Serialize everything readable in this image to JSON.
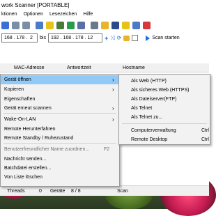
{
  "window": {
    "title": "work Scanner [PORTABLE]"
  },
  "menu": [
    "ktionen",
    "Optionen",
    "Lesezeichen",
    "Hilfe"
  ],
  "toolbar_icons": [
    {
      "name": "floppy-icon",
      "color": "#3a6fd6"
    },
    {
      "name": "document-icon",
      "color": "#7a8ea8"
    },
    {
      "name": "document-icon",
      "color": "#7a8ea8"
    },
    {
      "name": "monitor-icon",
      "color": "#4a7ac8"
    },
    {
      "name": "bulb-icon",
      "color": "#e8c21a"
    },
    {
      "name": "mountain-icon",
      "color": "#4a7a3a"
    },
    {
      "name": "globe-icon",
      "color": "#2b9a4a"
    },
    {
      "name": "settings-grid-icon",
      "color": "#5a6fa8"
    },
    {
      "name": "gear-icon",
      "color": "#6a7a8a"
    },
    {
      "name": "folder-icon",
      "color": "#e8b42a"
    },
    {
      "name": "terminal-icon",
      "color": "#2a4a8a"
    },
    {
      "name": "note-icon",
      "color": "#e8c21a"
    },
    {
      "name": "pen-icon",
      "color": "#4a7ac8"
    },
    {
      "name": "power-icon",
      "color": "#d63a3a"
    }
  ],
  "range": {
    "from": "168 . 178 .  2",
    "to_label": "bis",
    "to": "192 . 168 . 178 . 12"
  },
  "scan_button": "Scan starten",
  "columns": [
    "MAC-Adresse",
    "Antwortzeit",
    "Hostname"
  ],
  "context_menu": {
    "items": [
      {
        "label": "Gerät öffnen",
        "arrow": "›",
        "selected": true
      },
      {
        "label": "Kopieren",
        "arrow": "›"
      },
      {
        "label": "Eigenschaften"
      },
      {
        "label": "Gerät erneut scannen",
        "arrow": "›"
      },
      {
        "label": "Wake-On-LAN",
        "arrow": "›"
      },
      {
        "label": "Remote Herunterfahren"
      },
      {
        "label": "Remote Standby / Ruhezustand"
      },
      {
        "label": "Benutzerfreundlicher Name zuordnen...",
        "shortcut": "F2",
        "disabled": true
      },
      {
        "label": "Nachricht senden..."
      },
      {
        "label": "Batchdatei erstellen..."
      },
      {
        "label": "Von Liste löschen"
      }
    ]
  },
  "submenu": {
    "items": [
      {
        "label": "Als Web (HTTP)"
      },
      {
        "label": "Als sicheres Web (HTTPS)"
      },
      {
        "label": "Als Dateiserver(FTP)"
      },
      {
        "label": "Als Telnet"
      },
      {
        "label": "Als Telnet zu..."
      },
      {
        "label": "Computerverwaltung",
        "shortcut": "Ctrl"
      },
      {
        "label": "Remote Desktop",
        "shortcut": "Ctrl"
      }
    ]
  },
  "status": {
    "threads_label": "Threads",
    "threads_value": "0",
    "devices_label": "Geräte",
    "devices_value": "8 / 8",
    "scan_label": "Scan"
  }
}
